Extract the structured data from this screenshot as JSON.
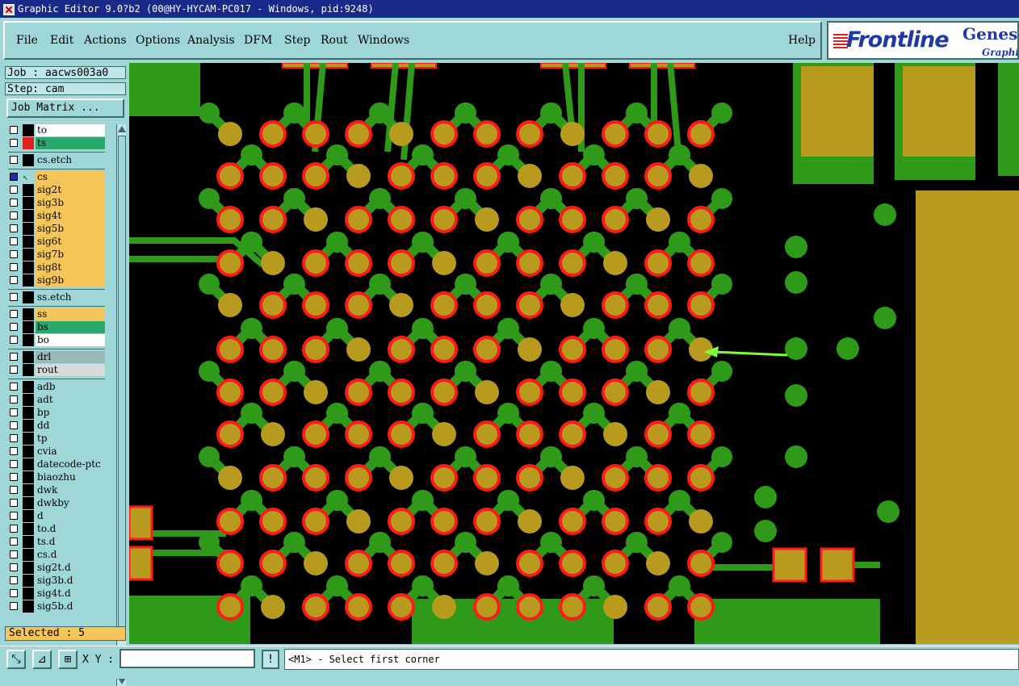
{
  "window": {
    "title": "Graphic Editor 9.0?b2 (00@HY-HYCAM-PC017 - Windows, pid:9248)"
  },
  "menu": {
    "items": [
      "File",
      "Edit",
      "Actions",
      "Options",
      "Analysis",
      "DFM",
      "Step",
      "Rout",
      "Windows"
    ],
    "help": "Help"
  },
  "brand": {
    "name": "Frontline",
    "product": "Genesis",
    "subtitle": "Graphic"
  },
  "job": {
    "job_label": "Job : aacws003a0",
    "step_label": "Step: cam",
    "matrix_button": "Job Matrix ..."
  },
  "layers": [
    {
      "name": "to",
      "color": "#ffffff",
      "swatch": "#000000",
      "group": 0
    },
    {
      "name": "ts",
      "color": "#2aa86e",
      "swatch": "#e02020",
      "group": 0
    },
    {
      "name": "cs.etch",
      "color": "#9fd7d9",
      "swatch": "#000000",
      "group": 1
    },
    {
      "name": "cs",
      "color": "#f7c65a",
      "swatch": "#000000",
      "group": 2,
      "active": true
    },
    {
      "name": "sig2t",
      "color": "#f7c65a",
      "swatch": "#000000",
      "group": 2
    },
    {
      "name": "sig3b",
      "color": "#f7c65a",
      "swatch": "#000000",
      "group": 2
    },
    {
      "name": "sig4t",
      "color": "#f7c65a",
      "swatch": "#000000",
      "group": 2
    },
    {
      "name": "sig5b",
      "color": "#f7c65a",
      "swatch": "#000000",
      "group": 2
    },
    {
      "name": "sig6t",
      "color": "#f7c65a",
      "swatch": "#000000",
      "group": 2
    },
    {
      "name": "sig7b",
      "color": "#f7c65a",
      "swatch": "#000000",
      "group": 2
    },
    {
      "name": "sig8t",
      "color": "#f7c65a",
      "swatch": "#000000",
      "group": 2
    },
    {
      "name": "sig9b",
      "color": "#f7c65a",
      "swatch": "#000000",
      "group": 2
    },
    {
      "name": "ss.etch",
      "color": "#9fd7d9",
      "swatch": "#000000",
      "group": 3
    },
    {
      "name": "ss",
      "color": "#f7c65a",
      "swatch": "#000000",
      "group": 4
    },
    {
      "name": "bs",
      "color": "#2aa86e",
      "swatch": "#000000",
      "group": 4
    },
    {
      "name": "bo",
      "color": "#ffffff",
      "swatch": "#000000",
      "group": 4
    },
    {
      "name": "drl",
      "color": "#9bb8b9",
      "swatch": "#000000",
      "group": 5
    },
    {
      "name": "rout",
      "color": "#d9d9d9",
      "swatch": "#000000",
      "group": 5
    },
    {
      "name": "adb",
      "color": "#9fd7d9",
      "swatch": "#000000",
      "group": 6
    },
    {
      "name": "adt",
      "color": "#9fd7d9",
      "swatch": "#000000",
      "group": 6
    },
    {
      "name": "bp",
      "color": "#9fd7d9",
      "swatch": "#000000",
      "group": 6
    },
    {
      "name": "dd",
      "color": "#9fd7d9",
      "swatch": "#000000",
      "group": 6
    },
    {
      "name": "tp",
      "color": "#9fd7d9",
      "swatch": "#000000",
      "group": 6
    },
    {
      "name": "cvia",
      "color": "#9fd7d9",
      "swatch": "#000000",
      "group": 6
    },
    {
      "name": "datecode-ptc",
      "color": "#9fd7d9",
      "swatch": "#000000",
      "group": 6
    },
    {
      "name": "biaozhu",
      "color": "#9fd7d9",
      "swatch": "#000000",
      "group": 6
    },
    {
      "name": "dwk",
      "color": "#9fd7d9",
      "swatch": "#000000",
      "group": 6
    },
    {
      "name": "dwkby",
      "color": "#9fd7d9",
      "swatch": "#000000",
      "group": 6
    },
    {
      "name": "d",
      "color": "#9fd7d9",
      "swatch": "#000000",
      "group": 6
    },
    {
      "name": "to.d",
      "color": "#9fd7d9",
      "swatch": "#000000",
      "group": 6
    },
    {
      "name": "ts.d",
      "color": "#9fd7d9",
      "swatch": "#000000",
      "group": 6
    },
    {
      "name": "cs.d",
      "color": "#9fd7d9",
      "swatch": "#000000",
      "group": 6
    },
    {
      "name": "sig2t.d",
      "color": "#9fd7d9",
      "swatch": "#000000",
      "group": 6
    },
    {
      "name": "sig3b.d",
      "color": "#9fd7d9",
      "swatch": "#000000",
      "group": 6
    },
    {
      "name": "sig4t.d",
      "color": "#9fd7d9",
      "swatch": "#000000",
      "group": 6
    },
    {
      "name": "sig5b.d",
      "color": "#9fd7d9",
      "swatch": "#000000",
      "group": 6
    }
  ],
  "selected": "Selected : 5",
  "xy": {
    "label": "X Y :",
    "value": ""
  },
  "status": "<M1> - Select first corner",
  "colors": {
    "copper": "#b89a1e",
    "trace": "#2f9a1a",
    "pad_ring": "#ff1a1a",
    "background": "#000000",
    "panel": "#9fd7d9"
  }
}
